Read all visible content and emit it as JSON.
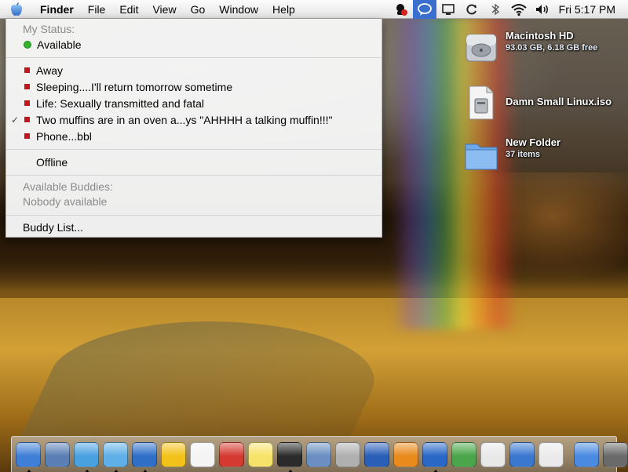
{
  "menubar": {
    "app_name": "Finder",
    "menus": [
      "File",
      "Edit",
      "View",
      "Go",
      "Window",
      "Help"
    ],
    "clock": "Fri 5:17 PM",
    "extras": [
      "ichat-buddy-icon",
      "ichat-status-icon",
      "display-icon",
      "sync-icon",
      "bluetooth-icon",
      "wifi-icon",
      "volume-icon"
    ]
  },
  "status_menu": {
    "my_status_header": "My Status:",
    "available": "Available",
    "away_items": [
      "Away",
      "Sleeping....I'll return tomorrow sometime",
      "Life: Sexually transmitted and fatal",
      "Two muffins are in an oven a...ys \"AHHHH a talking muffin!!!\"",
      "Phone...bbl"
    ],
    "checked_index": 3,
    "offline": "Offline",
    "buddies_header": "Available Buddies:",
    "buddies_empty": "Nobody available",
    "buddy_list": "Buddy List...",
    "checkmark": "✓"
  },
  "desktop_icons": [
    {
      "name": "Macintosh HD",
      "info": "93.03 GB, 6.18 GB free",
      "icon": "hard-drive-icon"
    },
    {
      "name": "Damn Small Linux.iso",
      "info": "",
      "icon": "disk-image-icon"
    },
    {
      "name": "New Folder",
      "info": "37 items",
      "icon": "folder-icon"
    }
  ],
  "dock": {
    "apps": [
      {
        "name": "finder",
        "color": "#3f7fd8",
        "running": true
      },
      {
        "name": "preview",
        "color": "#5a7fb5",
        "running": false
      },
      {
        "name": "safari",
        "color": "#4aa1e0",
        "running": true
      },
      {
        "name": "itunes",
        "color": "#5fb0e8",
        "running": true
      },
      {
        "name": "ichat",
        "color": "#2f6fc8",
        "running": true
      },
      {
        "name": "aim",
        "color": "#f2c21a",
        "running": false
      },
      {
        "name": "ical",
        "color": "#f4f4f4",
        "running": false
      },
      {
        "name": "toolbox",
        "color": "#d43a30",
        "running": false
      },
      {
        "name": "stickies",
        "color": "#f7e36a",
        "running": false
      },
      {
        "name": "garageband",
        "color": "#2b2b2b",
        "running": true
      },
      {
        "name": "iphoto",
        "color": "#6a8fc0",
        "running": false
      },
      {
        "name": "photo-booth",
        "color": "#b0b0b0",
        "running": false
      },
      {
        "name": "bluetooth",
        "color": "#2a5fb8",
        "running": false
      },
      {
        "name": "vlc",
        "color": "#e88a1c",
        "running": false
      },
      {
        "name": "adium",
        "color": "#2a68c8",
        "running": true
      },
      {
        "name": "downloader",
        "color": "#4aa64a",
        "running": false
      },
      {
        "name": "youtube",
        "color": "#e8e8e8",
        "running": false
      },
      {
        "name": "network-utility",
        "color": "#3a78d0",
        "running": false
      },
      {
        "name": "textedit",
        "color": "#eaeaea",
        "running": false
      }
    ],
    "right_items": [
      {
        "name": "applications",
        "color": "#4a8ae0"
      },
      {
        "name": "system-prefs",
        "color": "#6a6a6a"
      },
      {
        "name": "trash",
        "color": "#8a8a8a"
      }
    ]
  }
}
